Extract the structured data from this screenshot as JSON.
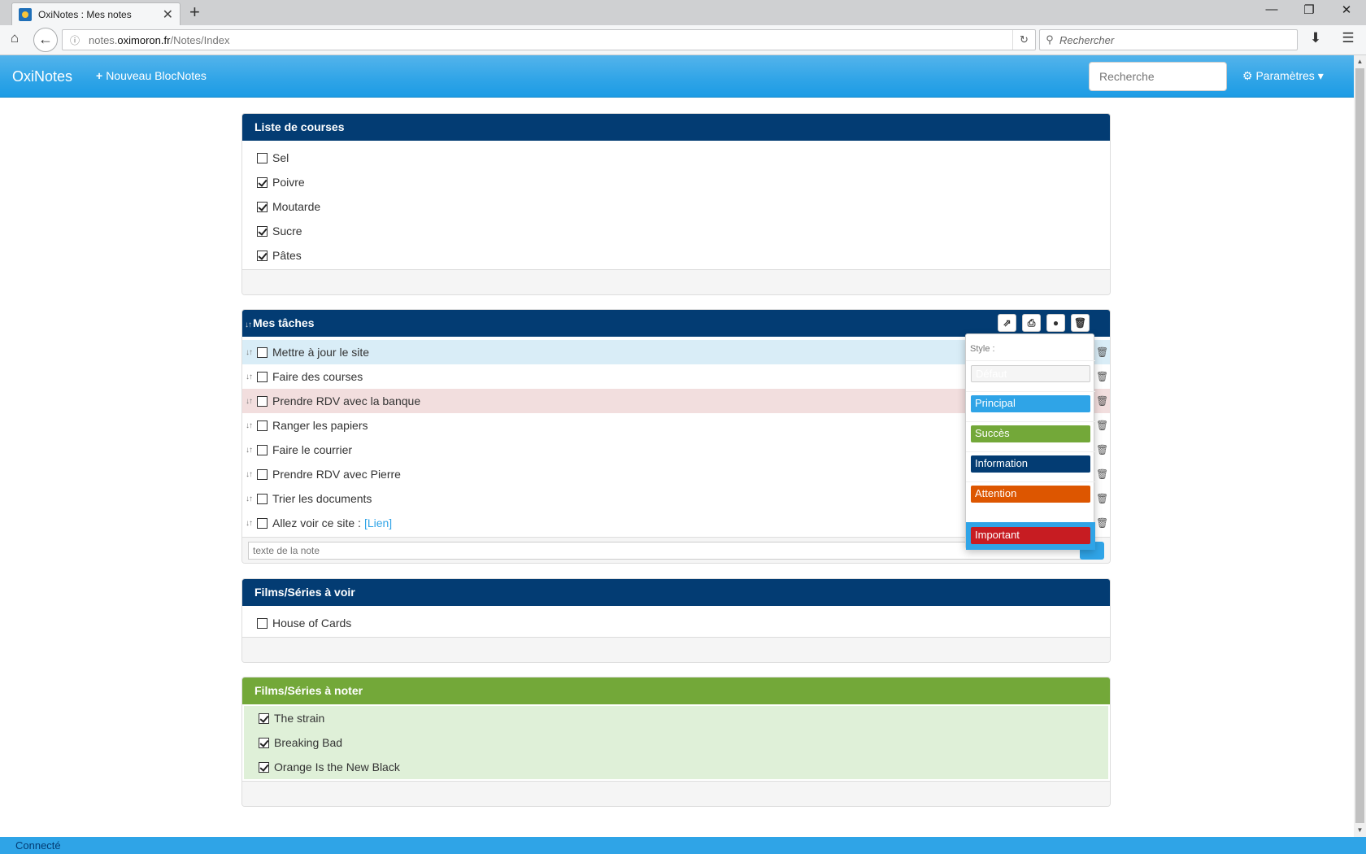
{
  "browser": {
    "tab_title": "OxiNotes : Mes notes",
    "tab_close": "✕",
    "new_tab": "+",
    "url_domain_prefix": "notes.",
    "url_domain": "oximoron.fr",
    "url_path": "/Notes/Index",
    "search_placeholder": "Rechercher",
    "win_minimize": "—",
    "win_restore": "❐",
    "win_close": "✕"
  },
  "app": {
    "brand": "OxiNotes",
    "new_block_icon": "+",
    "new_block_label": "Nouveau BlocNotes",
    "search_placeholder": "Recherche",
    "settings_label": "Paramètres",
    "settings_icon": "⚙",
    "settings_caret": "▾"
  },
  "panels": [
    {
      "title": "Liste de courses",
      "items": [
        {
          "label": "Sel",
          "checked": false
        },
        {
          "label": "Poivre",
          "checked": true
        },
        {
          "label": "Moutarde",
          "checked": true
        },
        {
          "label": "Sucre",
          "checked": true
        },
        {
          "label": "Pâtes",
          "checked": true
        }
      ]
    },
    {
      "title": "Mes tâches",
      "items": [
        {
          "label": "Mettre à jour le site",
          "checked": false,
          "style": "info"
        },
        {
          "label": "Faire des courses",
          "checked": false
        },
        {
          "label": "Prendre RDV avec la banque",
          "checked": false,
          "style": "danger"
        },
        {
          "label": "Ranger les papiers",
          "checked": false
        },
        {
          "label": "Faire le courrier",
          "checked": false
        },
        {
          "label": "Prendre RDV avec Pierre",
          "checked": false
        },
        {
          "label": "Trier les documents",
          "checked": false
        },
        {
          "label": "Allez voir ce site :",
          "checked": false,
          "link": "[Lien]"
        }
      ],
      "add_placeholder": "texte de la note",
      "style_menu": {
        "label": "Style :",
        "options": [
          "Défaut",
          "Principal",
          "Succès",
          "Information",
          "Attention",
          "Important"
        ]
      }
    },
    {
      "title": "Films/Séries à voir",
      "items": [
        {
          "label": "House of Cards",
          "checked": false
        }
      ]
    },
    {
      "title": "Films/Séries à noter",
      "items": [
        {
          "label": "The strain",
          "checked": true
        },
        {
          "label": "Breaking Bad",
          "checked": true
        },
        {
          "label": "Orange Is the New Black",
          "checked": true
        }
      ]
    }
  ],
  "status": "Connecté",
  "colors": {
    "primary": "#2fa4e7",
    "info_dark": "#033c73",
    "success": "#73a839",
    "warning": "#dd5600",
    "danger": "#c71c22"
  }
}
